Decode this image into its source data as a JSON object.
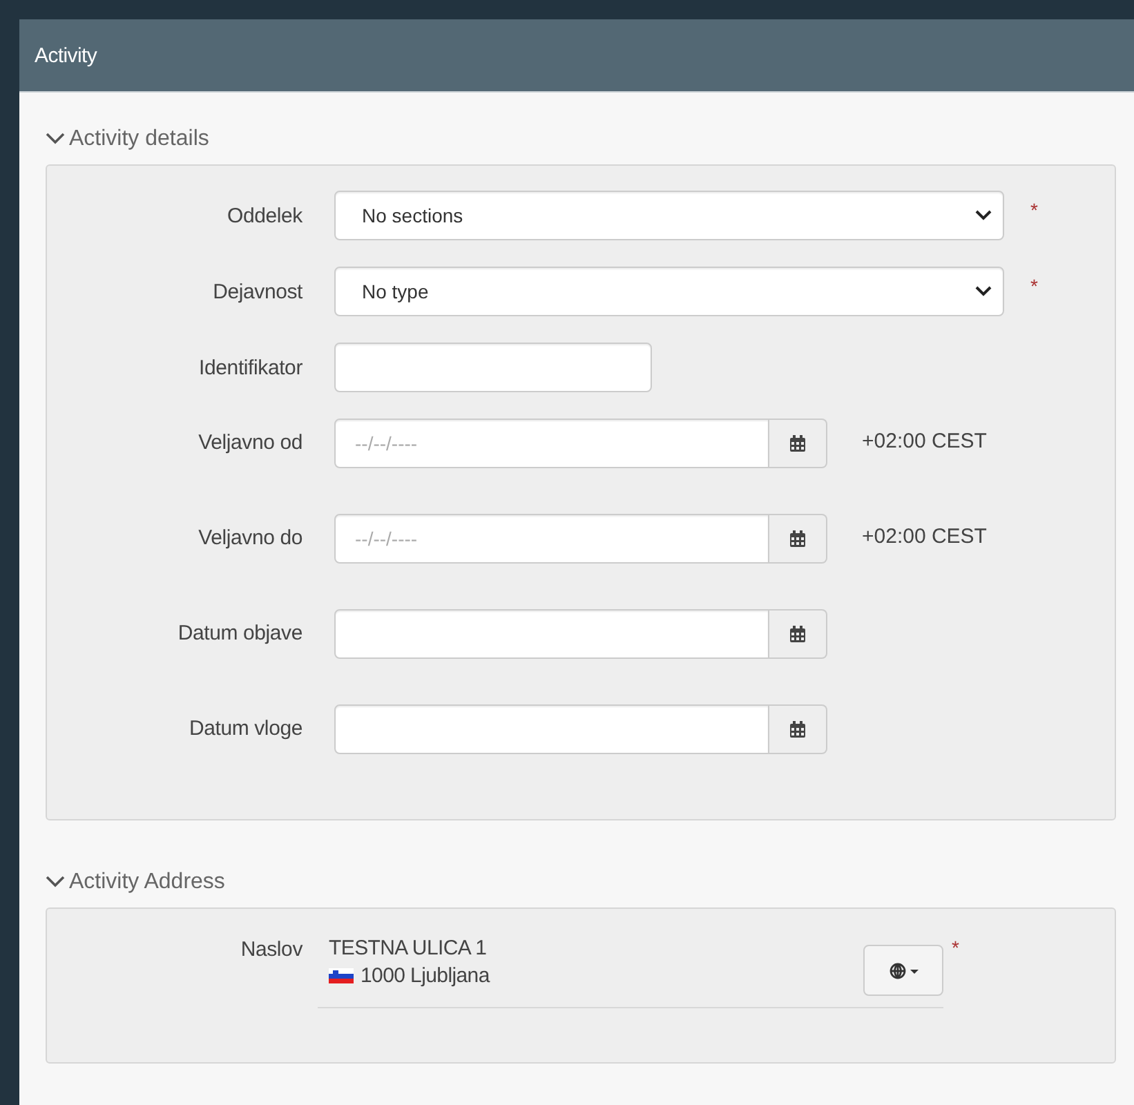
{
  "panel": {
    "title": "Activity"
  },
  "sections": [
    {
      "title": "Activity details",
      "expanded": true,
      "fields": [
        {
          "kind": "select",
          "label": "Oddelek",
          "value": "No sections",
          "required_mark": "*"
        },
        {
          "kind": "select",
          "label": "Dejavnost",
          "value": "No type",
          "required_mark": "*"
        },
        {
          "kind": "text",
          "label": "Identifikator"
        },
        {
          "kind": "date",
          "label": "Veljavno od",
          "placeholder": "--/--/----",
          "timezone": "+02:00 CEST"
        },
        {
          "kind": "date",
          "label": "Veljavno do",
          "placeholder": "--/--/----",
          "timezone": "+02:00 CEST"
        },
        {
          "kind": "date",
          "label": "Datum objave"
        },
        {
          "kind": "date",
          "label": "Datum vloge"
        }
      ]
    },
    {
      "title": "Activity Address",
      "expanded": true,
      "fields": [
        {
          "kind": "address",
          "label": "Naslov",
          "line1": "TESTNA ULICA 1",
          "line2": "1000 Ljubljana",
          "required_mark": "*"
        }
      ]
    }
  ]
}
